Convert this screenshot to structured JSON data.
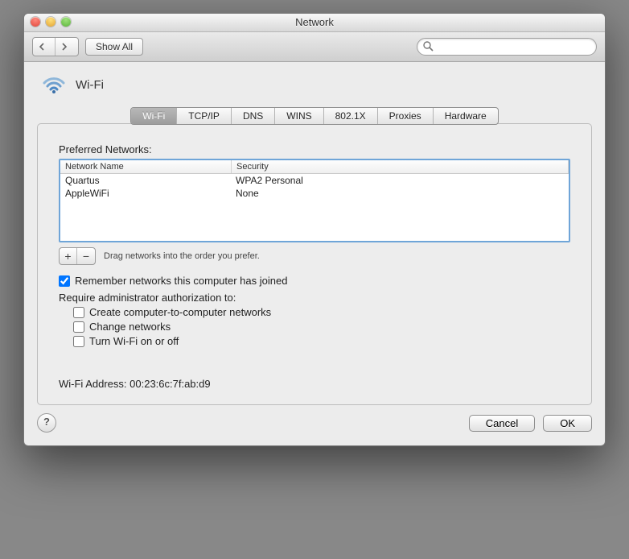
{
  "window": {
    "title": "Network"
  },
  "toolbar": {
    "show_all": "Show All",
    "search_placeholder": ""
  },
  "header": {
    "wifi_label": "Wi-Fi"
  },
  "tabs": [
    "Wi-Fi",
    "TCP/IP",
    "DNS",
    "WINS",
    "802.1X",
    "Proxies",
    "Hardware"
  ],
  "active_tab": 0,
  "sheet": {
    "preferred_label": "Preferred Networks:",
    "columns": {
      "name": "Network Name",
      "security": "Security"
    },
    "networks": [
      {
        "name": "Quartus",
        "security": "WPA2 Personal"
      },
      {
        "name": "AppleWiFi",
        "security": "None"
      }
    ],
    "drag_hint": "Drag networks into the order you prefer.",
    "remember_label": "Remember networks this computer has joined",
    "remember_checked": true,
    "admin_label": "Require administrator authorization to:",
    "admin_opts": {
      "create": "Create computer-to-computer networks",
      "change": "Change networks",
      "toggle": "Turn Wi-Fi on or off"
    },
    "address_label": "Wi-Fi Address:",
    "address_value": "00:23:6c:7f:ab:d9"
  },
  "buttons": {
    "cancel": "Cancel",
    "ok": "OK"
  }
}
